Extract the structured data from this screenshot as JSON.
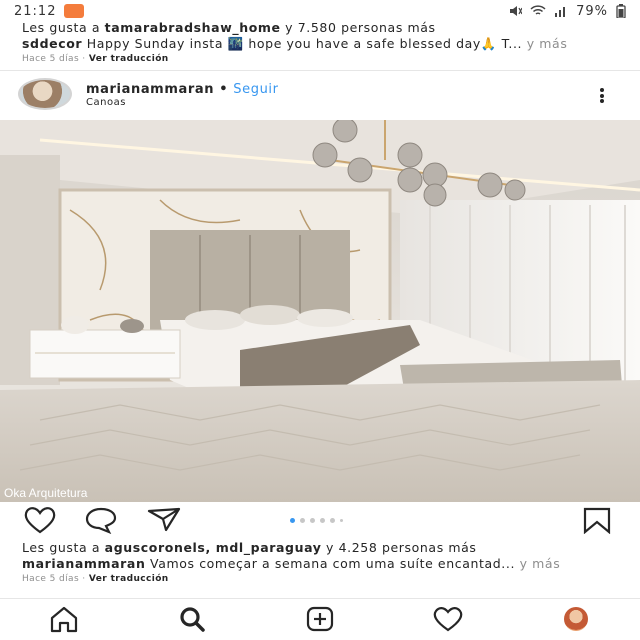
{
  "status_bar": {
    "time": "21:12",
    "battery": "79%"
  },
  "previous_post": {
    "likes_prefix": "Les gusta a ",
    "likes_user": "tamarabradshaw_home",
    "likes_suffix": " y 7.580 personas más",
    "caption_user": "sddecor",
    "caption_text": " Happy Sunday insta 🌃 hope you have a safe blessed day🙏 T...",
    "more": " y más",
    "time_ago": "Hace 5 días",
    "translate": "Ver traducción"
  },
  "post": {
    "username": "marianammaran",
    "follow": "Seguir",
    "location": "Canoas",
    "watermark": "Oka Arquitetura",
    "likes_prefix": "Les gusta a ",
    "likes_users": "aguscoronels, mdl_paraguay",
    "likes_suffix": " y 4.258 personas más",
    "caption_user": "marianammaran",
    "caption_text": " Vamos começar a semana com uma suíte encantad...",
    "more": " y más",
    "time_ago": "Hace 5 días",
    "translate": "Ver traducción",
    "carousel": {
      "count": 6,
      "active": 1
    }
  },
  "icons": {
    "actions": [
      "heart-icon",
      "comment-icon",
      "share-icon",
      "bookmark-icon"
    ],
    "nav": [
      "home-icon",
      "search-icon",
      "add-post-icon",
      "activity-heart-icon",
      "profile-avatar"
    ]
  },
  "colors": {
    "link": "#3897f0",
    "status_badge": "#f47c3c",
    "text": "#262626",
    "muted": "#8e8e8e"
  }
}
